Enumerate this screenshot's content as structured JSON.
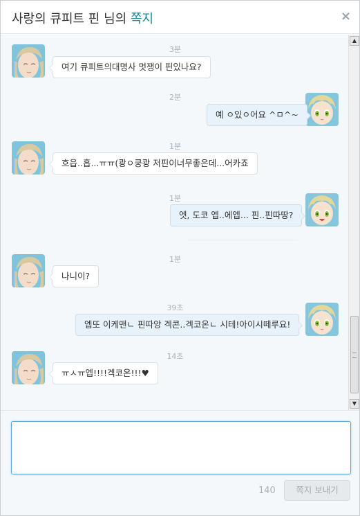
{
  "header": {
    "title_prefix": "사랑의 큐피트 핀 님의 ",
    "title_accent": "쪽지",
    "close_label": "×"
  },
  "colors": {
    "accent": "#1a8a9c",
    "incoming_bubble": "#ffffff",
    "outgoing_bubble": "#e7f2fa",
    "thread_bg": "#f5f8fa",
    "input_focus": "#5ba6d8"
  },
  "messages": [
    {
      "time": "3분",
      "side": "in",
      "text": "여기 큐피트의대명사 멋쟁이 핀있나요?"
    },
    {
      "time": "2분",
      "side": "out",
      "text": "예 ㅇ있ㅇ어요 ^ㅁ^~"
    },
    {
      "time": "1분",
      "side": "in",
      "text": "흐읍..흡...ㅠㅠ(쾅ㅇ쿵쾅 저핀이너무좋은데...어카죠"
    },
    {
      "time": "1분",
      "side": "out",
      "text": "엣, 도코 엡..에엡... 핀..핀따땅?"
    },
    {
      "time": "1분",
      "side": "in",
      "text": "나니이?"
    },
    {
      "time": "39초",
      "side": "out",
      "text": "엡또 이케맨ㄴ 핀따앙 겍콘..겍코온ㄴ 시테!아이시떼루요!"
    },
    {
      "time": "14초",
      "side": "in",
      "text": "ㅠㅅㅠ엡!!!!겍코온!!!♥"
    }
  ],
  "scrollbar": {
    "up_arrow": "▲",
    "down_arrow": "▼"
  },
  "compose": {
    "value": "",
    "placeholder": "",
    "char_count": "140",
    "send_label": "쪽지 보내기"
  }
}
